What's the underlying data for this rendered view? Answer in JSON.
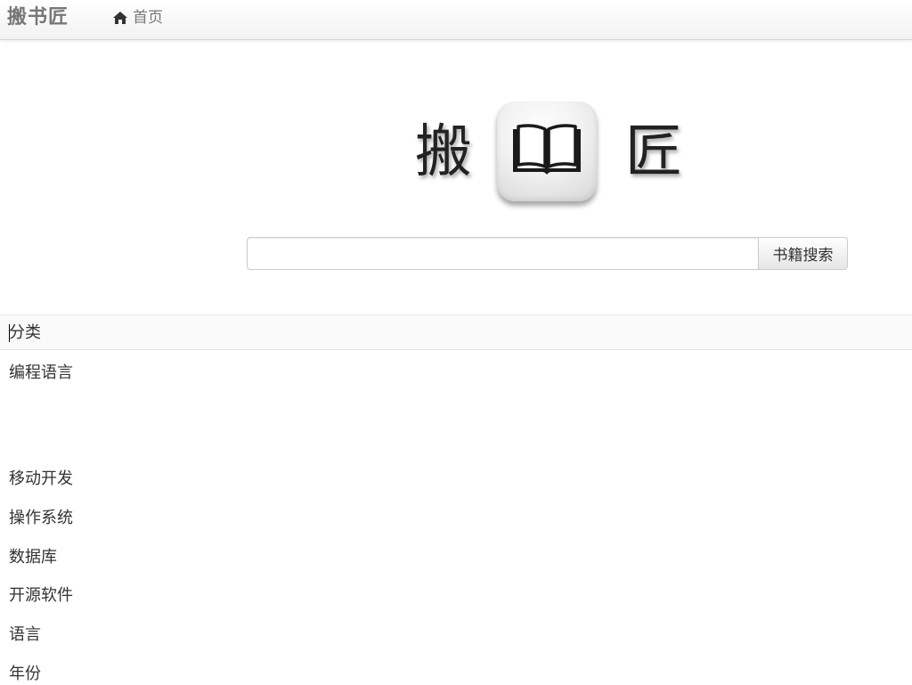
{
  "navbar": {
    "brand": "搬书匠",
    "home_icon": "home-icon",
    "home_label": "首页"
  },
  "logo": {
    "left_char": "搬",
    "icon": "open-book-icon",
    "right_char": "匠"
  },
  "search": {
    "value": "",
    "placeholder": "",
    "button_label": "书籍搜索"
  },
  "categories": {
    "header": "分类",
    "items": [
      {
        "label": "编程语言"
      },
      {
        "label": "移动开发"
      },
      {
        "label": "操作系统"
      },
      {
        "label": "数据库"
      },
      {
        "label": "开源软件"
      },
      {
        "label": "语言"
      },
      {
        "label": "年份"
      }
    ]
  },
  "colors": {
    "navbar_text": "#777777",
    "body_text": "#333333",
    "border": "#cccccc"
  }
}
